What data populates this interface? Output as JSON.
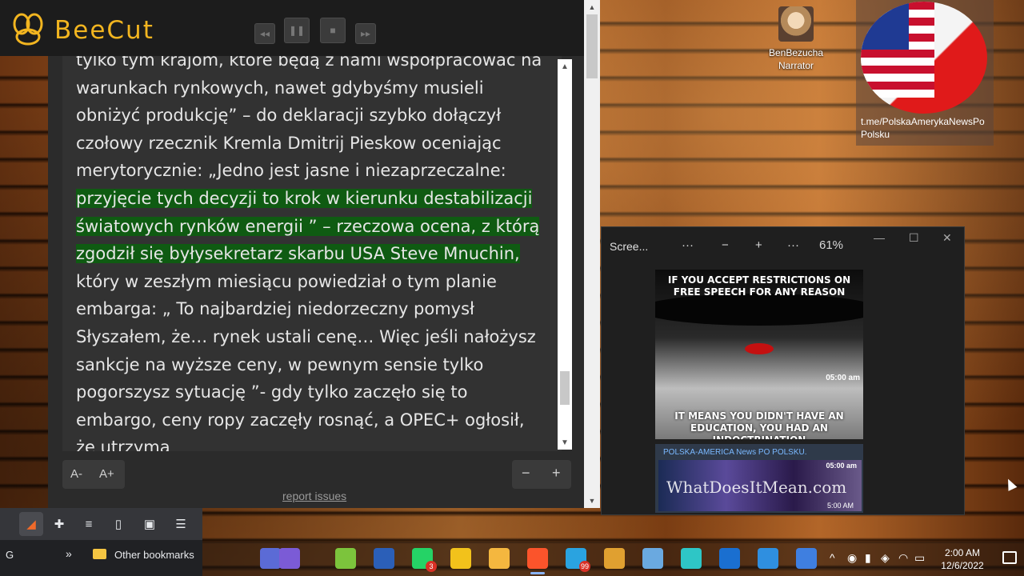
{
  "beecut": {
    "app_name": "BeeCut",
    "controls": [
      {
        "name": "rewind-button",
        "glyph": "◂◂"
      },
      {
        "name": "pause-button",
        "glyph": "❚❚"
      },
      {
        "name": "stop-button",
        "glyph": "■"
      },
      {
        "name": "forward-button",
        "glyph": "▸▸"
      }
    ]
  },
  "reader": {
    "text_before": "tylko tym krajom, które będą z nami współpracować na warunkach rynkowych, nawet gdybyśmy musieli obniżyć produkcję” – do deklaracji szybko dołączył czołowy rzecznik Kremla Dmitrij Pieskow oceniając merytorycznie: „Jedno jest jasne i niezaprzeczalne: ",
    "text_highlight": "przyjęcie tych decyzji to krok w kierunku destabilizacji światowych rynków energii ” – rzeczowa ocena, z którą zgodził się byłysekretarz skarbu USA Steve Mnuchin,",
    "text_after": " który w zeszłym miesiącu powiedział o tym planie embarga: „ To najbardziej niedorzeczny pomysł Słyszałem, że… rynek ustali cenę… Więc jeśli nałożysz sankcje na wyższe ceny, w pewnym sensie tylko pogorszysz sytuację ”- gdy tylko zaczęło się to embargo, ceny ropy zaczęły rosnąć, a OPEC+ ogłosił, że utrzyma",
    "font_decrease": "A-",
    "font_increase": "A+",
    "zoom_minus": "−",
    "zoom_plus": "+",
    "report_link": "report issues"
  },
  "desktop": {
    "narrator_label_1": "BenBezucha",
    "narrator_label_2": "Narrator",
    "flag_label": "t.me/PolskaAmerykaNewsPo Polsku"
  },
  "snip_window": {
    "title": "Scree...",
    "more_1": "···",
    "zoom_out": "−",
    "zoom_in": "+",
    "more_2": "···",
    "zoom_level": "61%",
    "minimize": "—",
    "maximize": "☐",
    "close": "✕",
    "meme_top": "IF YOU ACCEPT RESTRICTIONS ON FREE SPEECH FOR ANY REASON",
    "meme_time": "05:00 am",
    "meme_bottom": "IT MEANS YOU DIDN'T HAVE AN EDUCATION, YOU HAD AN INDOCTRINATION",
    "channel_name": "POLSKA-AMERICA News PO POLSKU.",
    "thumb_time_top": "05:00 am",
    "thumb_text": "WhatDoesItMean.com",
    "thumb_time_bottom": "5:00 AM"
  },
  "browser": {
    "profile_letter": "G",
    "chevron": "»",
    "other_bookmarks": "Other bookmarks"
  },
  "taskbar": {
    "time": "2:00 AM",
    "date": "12/6/2022",
    "whatsapp_badge": "3",
    "telegram_badge": "99",
    "apps": [
      {
        "name": "edge-dev-icon",
        "color": "#5b6bd6"
      },
      {
        "name": "teams-icon",
        "color": "#7b5bd6"
      },
      {
        "name": "android-icon",
        "color": "#7cc43c"
      },
      {
        "name": "word-icon",
        "color": "#2b5fb8"
      },
      {
        "name": "whatsapp-icon",
        "color": "#25d366"
      },
      {
        "name": "notes-icon",
        "color": "#f2c21b"
      },
      {
        "name": "file-explorer-icon",
        "color": "#f4b73f"
      },
      {
        "name": "brave-icon",
        "color": "#fb542b"
      },
      {
        "name": "telegram-icon",
        "color": "#2aa3e0"
      },
      {
        "name": "python-icon",
        "color": "#e0a030"
      },
      {
        "name": "notepad-icon",
        "color": "#6aa9e0"
      },
      {
        "name": "snip-icon",
        "color": "#2ec6c6"
      },
      {
        "name": "video-icon",
        "color": "#1a6fd0"
      },
      {
        "name": "photos-icon",
        "color": "#2f8fe0"
      },
      {
        "name": "cortana-icon",
        "color": "#3f7fe0"
      }
    ]
  }
}
